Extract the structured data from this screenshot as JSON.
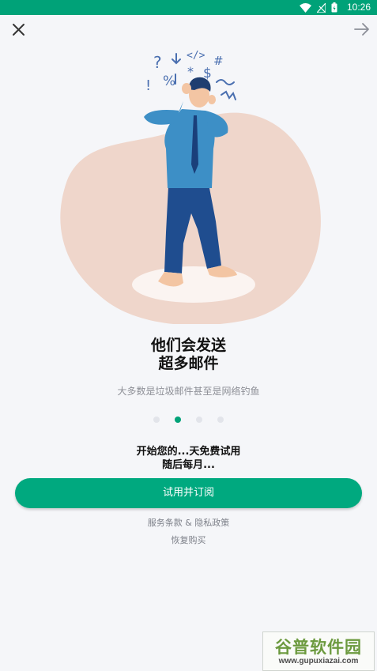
{
  "status_bar": {
    "time": "10:26",
    "icons": [
      "wifi-icon",
      "no-signal-icon",
      "battery-icon"
    ]
  },
  "nav": {
    "close_icon": "close-icon",
    "next_icon": "arrow-right-icon"
  },
  "illustration": {
    "subject": "confused-man-many-emails",
    "symbols": [
      "?",
      "%",
      "$",
      "!",
      "#",
      "</>",
      "*",
      "~"
    ]
  },
  "headline": {
    "line1": "他们会发送",
    "line2": "超多邮件"
  },
  "subtitle": "大多数是垃圾邮件甚至是网络钓鱼",
  "pager": {
    "count": 4,
    "active_index": 1
  },
  "trial": {
    "line1": "开始您的...天免费试用",
    "line2": "随后每月..."
  },
  "cta_label": "试用并订阅",
  "legal": {
    "terms": "服务条款",
    "separator": " & ",
    "privacy": "隐私政策"
  },
  "restore_label": "恢复购买",
  "watermark": {
    "logo_text": "谷普软件园",
    "url": "www.gupuxiazai.com"
  },
  "colors": {
    "status_bar": "#00a278",
    "accent": "#00a97f",
    "dot_inactive": "#e2e4ea",
    "blob": "#efd6cb",
    "shirt": "#3d8fc6",
    "pants": "#1f4d8f"
  }
}
